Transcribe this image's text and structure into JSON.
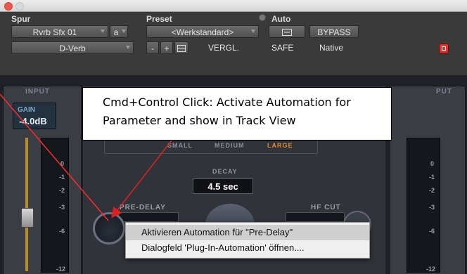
{
  "header": {
    "track_label": "Spur",
    "preset_label": "Preset",
    "auto_label": "Auto",
    "track_name": "Rvrb Sfx 01",
    "track_channel": "a",
    "plugin_name": "D-Verb",
    "preset_value": "<Werkstandard>",
    "minus_label": "-",
    "plus_label": "+",
    "compare_label": "VERGL.",
    "bypass_label": "BYPASS",
    "safe_label": "SAFE",
    "native_label": "Native"
  },
  "plugin": {
    "input_label": "INPUT",
    "output_label": "PUT",
    "gain_label": "GAIN",
    "gain_value": "-4.0dB",
    "size_small": "SMALL",
    "size_medium": "MEDIUM",
    "size_large": "LARGE",
    "decay_label": "DECAY",
    "decay_value": "4.5 sec",
    "predelay_label": "PRE-DELAY",
    "hfcut_label": "HF CUT",
    "scale_left": [
      "0",
      "-1",
      "-2",
      "-3",
      "-6",
      "-12"
    ],
    "scale_right": [
      "0",
      "-1",
      "-2",
      "-3",
      "-6",
      "-12"
    ]
  },
  "context_menu": {
    "items": [
      "Aktivieren Automation für \"Pre-Delay\"",
      "Dialogfeld 'Plug-In-Automation' öffnen...."
    ]
  },
  "callout": {
    "line1": "Cmd+Control Click: Activate Automation for",
    "line2": "Parameter and show in Track View"
  },
  "colors": {
    "accent_orange": "#e08a2e",
    "close_red": "#dd3333",
    "arrow_red": "#e02020"
  }
}
